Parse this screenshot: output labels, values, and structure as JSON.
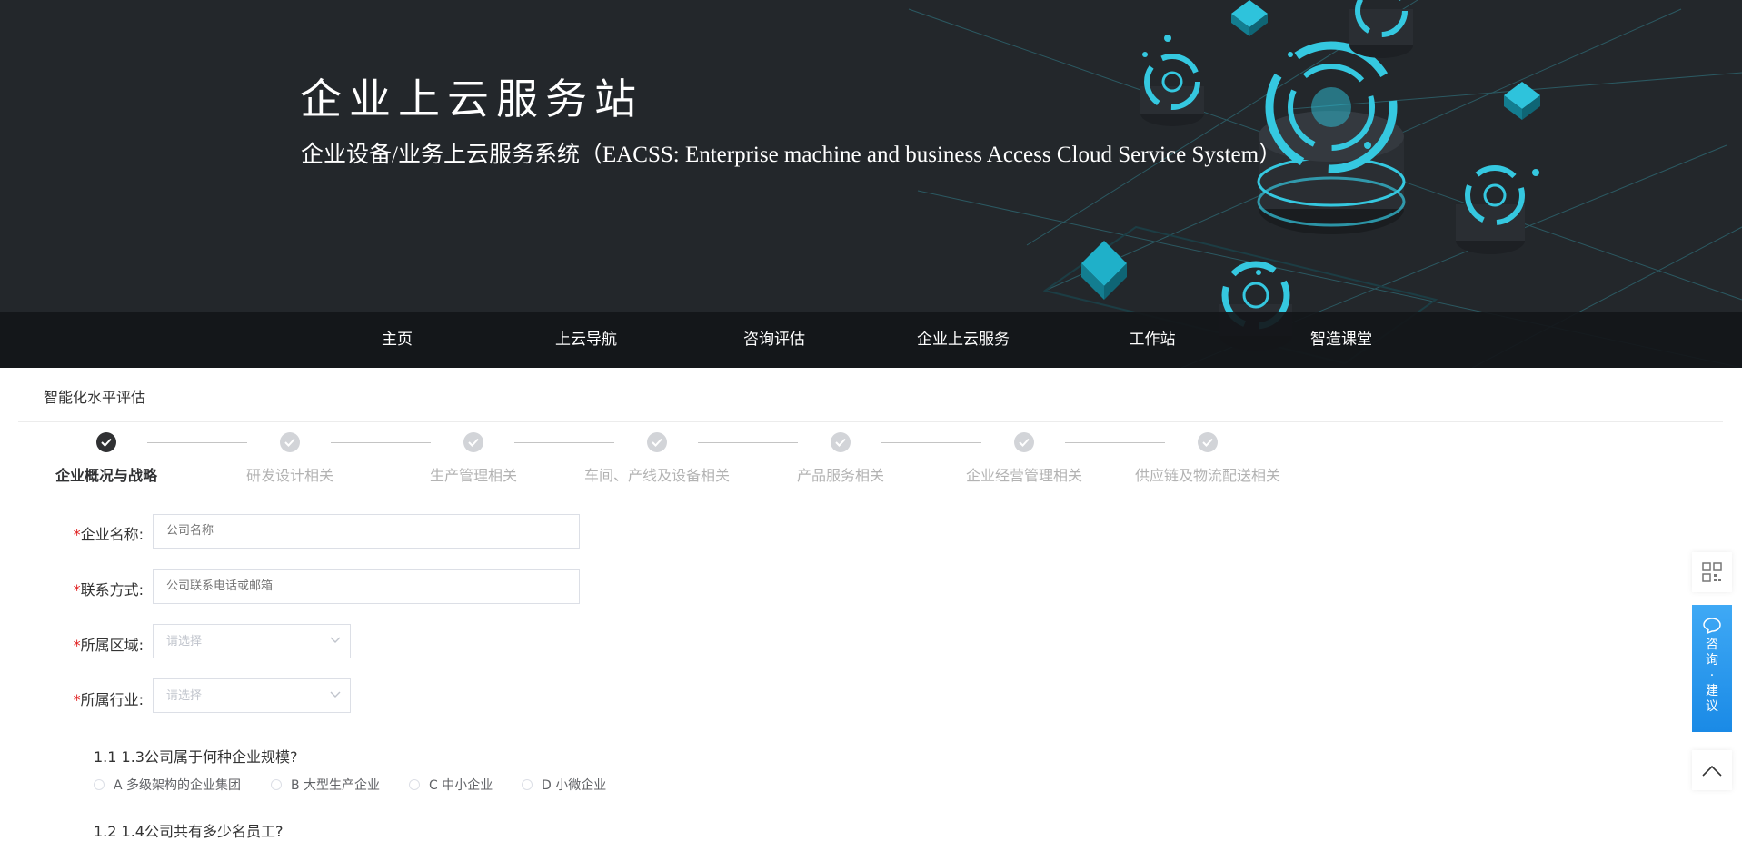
{
  "banner": {
    "title": "企业上云服务站",
    "subtitle": "企业设备/业务上云服务系统（EACSS: Enterprise machine and business Access Cloud Service System）"
  },
  "nav": {
    "items": [
      {
        "label": "主页"
      },
      {
        "label": "上云导航"
      },
      {
        "label": "咨询评估"
      },
      {
        "label": "企业上云服务"
      },
      {
        "label": "工作站"
      },
      {
        "label": "智造课堂"
      }
    ]
  },
  "page": {
    "title": "智能化水平评估"
  },
  "steps": {
    "active_index": 0,
    "items": [
      {
        "label": "企业概况与战略"
      },
      {
        "label": "研发设计相关"
      },
      {
        "label": "生产管理相关"
      },
      {
        "label": "车间、产线及设备相关"
      },
      {
        "label": "产品服务相关"
      },
      {
        "label": "企业经营管理相关"
      },
      {
        "label": "供应链及物流配送相关"
      }
    ]
  },
  "form": {
    "required_mark": "*",
    "company_name": {
      "label": "企业名称:",
      "placeholder": "公司名称",
      "value": ""
    },
    "contact": {
      "label": "联系方式:",
      "placeholder": "公司联系电话或邮箱",
      "value": ""
    },
    "region": {
      "label": "所属区域:",
      "placeholder": "请选择"
    },
    "industry": {
      "label": "所属行业:",
      "placeholder": "请选择"
    }
  },
  "questions": [
    {
      "text": "1.1 1.3公司属于何种企业规模?",
      "options": [
        {
          "label": "A 多级架构的企业集团"
        },
        {
          "label": "B 大型生产企业"
        },
        {
          "label": "C 中小企业"
        },
        {
          "label": "D 小微企业"
        }
      ]
    },
    {
      "text": "1.2 1.4公司共有多少名员工?"
    }
  ],
  "sidebar": {
    "consult_label": "咨询·建议"
  },
  "colors": {
    "banner_bg": "#23272b",
    "accent_cyan": "#35c8e0",
    "required_red": "#e02020",
    "consult_blue": "#1a8ae6"
  }
}
